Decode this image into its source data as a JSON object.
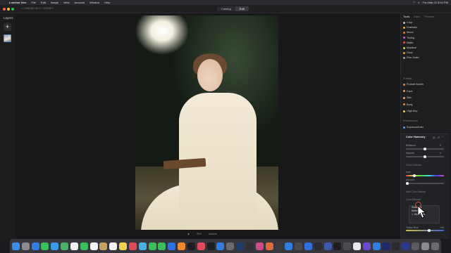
{
  "menubar": {
    "app_name": "Luminar Neo",
    "items": [
      "File",
      "Edit",
      "Image",
      "View",
      "Account",
      "Window",
      "Help"
    ],
    "clock": "Thu Mar 21 8:04 PM"
  },
  "titlebar": {
    "breadcrumb": "< LUMINAR NEO > SCENES",
    "view_tabs": [
      {
        "label": "Catalog"
      },
      {
        "label": "Edit"
      }
    ]
  },
  "left_panel": {
    "title": "Layers",
    "add_label": "+"
  },
  "right_panel": {
    "tabs": [
      {
        "label": "Tools"
      },
      {
        "label": "Edits"
      },
      {
        "label": "Presets"
      }
    ],
    "essentials": [
      {
        "label": "Crop",
        "color": "#c0c0c4"
      },
      {
        "label": "Dramatic",
        "color": "#e0b040"
      },
      {
        "label": "Mood",
        "color": "#e07a3a"
      },
      {
        "label": "Toning",
        "color": "#c85ad0"
      },
      {
        "label": "Matte",
        "color": "#e05050"
      },
      {
        "label": "Mystical",
        "color": "#d0d060"
      },
      {
        "label": "Glow",
        "color": "#e0a040"
      },
      {
        "label": "Film Grain",
        "color": "#a0a0a0"
      }
    ],
    "portrait_section": "Portrait",
    "portrait": [
      {
        "label": "Portrait Bokeh",
        "color": "#d09060"
      },
      {
        "label": "Face",
        "color": "#e0a070"
      },
      {
        "label": "Skin",
        "color": "#e0b090"
      },
      {
        "label": "Body",
        "color": "#e09050"
      },
      {
        "label": "High Key",
        "color": "#e0d070"
      }
    ],
    "professional_section": "Professional",
    "professional": [
      {
        "label": "Supercontrast",
        "color": "#6a9ae0"
      }
    ],
    "color_harmony": {
      "title": "Color Harmony",
      "sliders": [
        {
          "label": "Brilliance",
          "value": "0",
          "pos": 0.5
        },
        {
          "label": "Warmth",
          "value": "0",
          "pos": 0.5
        }
      ],
      "color_contrast_label": "Color Contrast",
      "hue_label": "Hue",
      "amount_label": "Amount",
      "split_toning_label": "Split Color Warmth",
      "color_balance_label": "Color Balance",
      "dropdown_options": [
        "Shadows",
        "Midtones",
        "Highlights"
      ],
      "selected_option": "Highlights",
      "yellow_blue_label": "Yellow-Blue",
      "yellow_blue_value": "+15"
    }
  },
  "bottombar": {
    "zoom": "25%",
    "actions": "Actions"
  }
}
